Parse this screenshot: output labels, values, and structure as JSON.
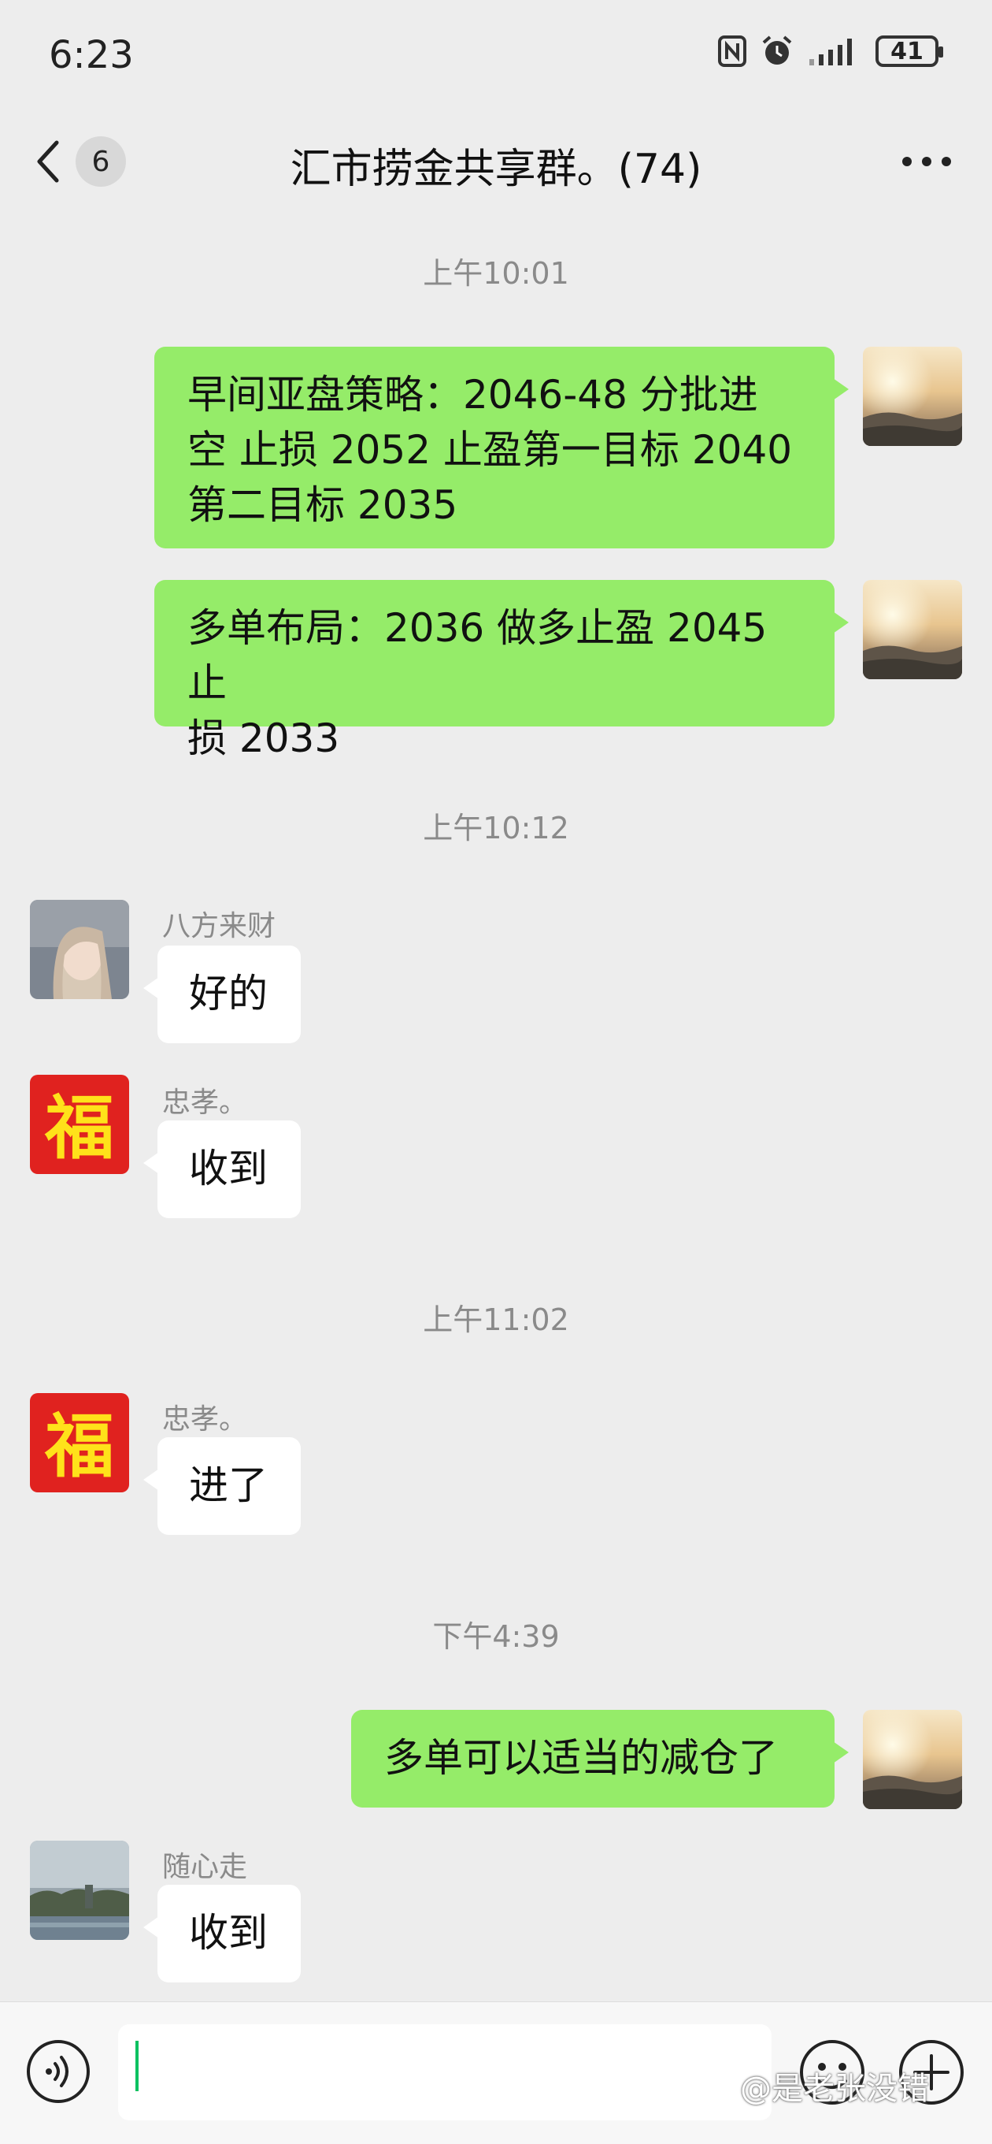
{
  "status_bar": {
    "time": "6:23",
    "battery": "41"
  },
  "header": {
    "back_badge": "6",
    "title": "汇市捞金共享群。(74)"
  },
  "messages": {
    "ts1": "上午10:01",
    "m1_line1": "早间亚盘策略：2046-48 分批进",
    "m1_line2": "空  止损 2052 止盈第一目标 2040",
    "m1_line3": "第二目标 2035",
    "m2_line1": "多单布局：2036 做多止盈 2045 止",
    "m2_line2": "损 2033",
    "ts2": "上午10:12",
    "m3_sender": "八方来财",
    "m3_text": "好的",
    "m4_sender": "忠孝。",
    "m4_text": "收到",
    "ts3": "上午11:02",
    "m5_sender": "忠孝。",
    "m5_text": "进了",
    "ts4": "下午4:39",
    "m6_text": "多单可以适当的减仓了",
    "m7_sender": "随心走",
    "m7_text": "收到"
  },
  "avatar_fu_char": "福",
  "input": {
    "value": ""
  },
  "watermark": "@是老张没错",
  "colors": {
    "outgoing_bubble": "#95ec69",
    "background": "#ededed",
    "caret": "#07c160"
  }
}
